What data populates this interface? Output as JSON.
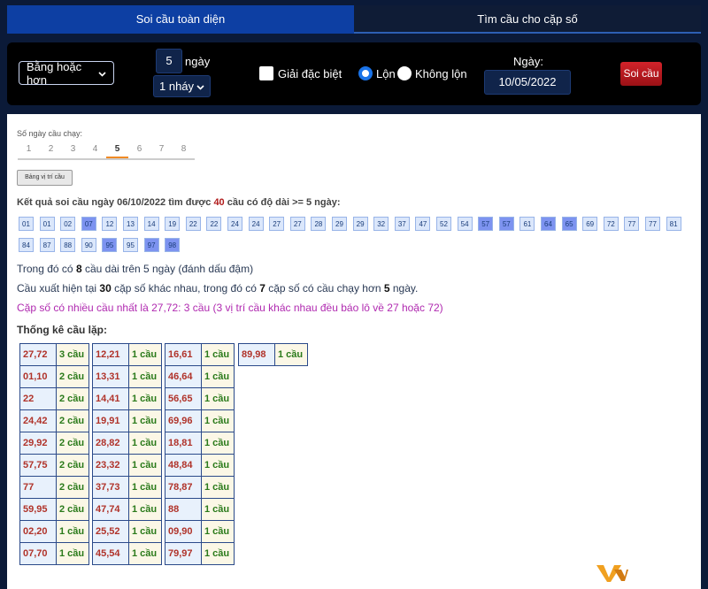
{
  "tabs": [
    {
      "label": "Soi cầu toàn diện"
    },
    {
      "label": "Tìm cầu cho cặp số"
    }
  ],
  "controls": {
    "mode_select": "Bằng hoặc hơn",
    "days_value": "5",
    "days_unit": "ngày",
    "jump_select": "1 nháy",
    "special_prize_label": "Giải đặc biệt",
    "radio_lon": "Lộn",
    "radio_khong_lon": "Không lộn",
    "date_label": "Ngày:",
    "date_value": "10/05/2022",
    "submit_label": "Soi cầu"
  },
  "content": {
    "days_title": "Số ngày cầu chạy:",
    "day_tabs": [
      "1",
      "2",
      "3",
      "4",
      "5",
      "6",
      "7",
      "8"
    ],
    "active_day": "5",
    "position_button": "Bảng vị trí cầu",
    "result_prefix": "Kết quả soi cầu ngày 06/10/2022 tìm được ",
    "result_count": "40",
    "result_suffix": " cầu có độ dài >= 5 ngày:",
    "chips": [
      {
        "v": "01",
        "b": false
      },
      {
        "v": "01",
        "b": false
      },
      {
        "v": "02",
        "b": false
      },
      {
        "v": "07",
        "b": true
      },
      {
        "v": "12",
        "b": false
      },
      {
        "v": "13",
        "b": false
      },
      {
        "v": "14",
        "b": false
      },
      {
        "v": "19",
        "b": false
      },
      {
        "v": "22",
        "b": false
      },
      {
        "v": "22",
        "b": false
      },
      {
        "v": "24",
        "b": false
      },
      {
        "v": "24",
        "b": false
      },
      {
        "v": "27",
        "b": false
      },
      {
        "v": "27",
        "b": false
      },
      {
        "v": "28",
        "b": false
      },
      {
        "v": "29",
        "b": false
      },
      {
        "v": "29",
        "b": false
      },
      {
        "v": "32",
        "b": false
      },
      {
        "v": "37",
        "b": false
      },
      {
        "v": "47",
        "b": false
      },
      {
        "v": "52",
        "b": false
      },
      {
        "v": "54",
        "b": false
      },
      {
        "v": "57",
        "b": true
      },
      {
        "v": "57",
        "b": true
      },
      {
        "v": "61",
        "b": false
      },
      {
        "v": "64",
        "b": true
      },
      {
        "v": "65",
        "b": true
      },
      {
        "v": "69",
        "b": false
      },
      {
        "v": "72",
        "b": false
      },
      {
        "v": "77",
        "b": false
      },
      {
        "v": "77",
        "b": false
      },
      {
        "v": "81",
        "b": false
      },
      {
        "v": "84",
        "b": false
      },
      {
        "v": "87",
        "b": false
      },
      {
        "v": "88",
        "b": false
      },
      {
        "v": "90",
        "b": false
      },
      {
        "v": "95",
        "b": true
      },
      {
        "v": "95",
        "b": false
      },
      {
        "v": "97",
        "b": true
      },
      {
        "v": "98",
        "b": true
      }
    ],
    "line1": {
      "a": "Trong đó có ",
      "b": "8",
      "c": " cầu dài trên 5 ngày (đánh dấu đậm)"
    },
    "line2": {
      "a": "Cầu xuất hiện tại ",
      "b": "30",
      "c": " cặp số khác nhau, trong đó có ",
      "d": "7",
      "e": " cặp số có cầu chạy hơn ",
      "f": "5",
      "g": " ngày."
    },
    "line3": "Cặp số có nhiều cầu nhất là 27,72: 3 cầu (3 vị trí cầu khác nhau đều báo lô về 27 hoặc 72)",
    "stat_title": "Thống kê cầu lặp:",
    "stat_tables": [
      [
        [
          "27,72",
          "3 cầu"
        ],
        [
          "01,10",
          "2 cầu"
        ],
        [
          "22",
          "2 cầu"
        ],
        [
          "24,42",
          "2 cầu"
        ],
        [
          "29,92",
          "2 cầu"
        ],
        [
          "57,75",
          "2 cầu"
        ],
        [
          "77",
          "2 cầu"
        ],
        [
          "59,95",
          "2 cầu"
        ],
        [
          "02,20",
          "1 cầu"
        ],
        [
          "07,70",
          "1 cầu"
        ]
      ],
      [
        [
          "12,21",
          "1 cầu"
        ],
        [
          "13,31",
          "1 cầu"
        ],
        [
          "14,41",
          "1 cầu"
        ],
        [
          "19,91",
          "1 cầu"
        ],
        [
          "28,82",
          "1 cầu"
        ],
        [
          "23,32",
          "1 cầu"
        ],
        [
          "37,73",
          "1 cầu"
        ],
        [
          "47,74",
          "1 cầu"
        ],
        [
          "25,52",
          "1 cầu"
        ],
        [
          "45,54",
          "1 cầu"
        ]
      ],
      [
        [
          "16,61",
          "1 cầu"
        ],
        [
          "46,64",
          "1 cầu"
        ],
        [
          "56,65",
          "1 cầu"
        ],
        [
          "69,96",
          "1 cầu"
        ],
        [
          "18,81",
          "1 cầu"
        ],
        [
          "48,84",
          "1 cầu"
        ],
        [
          "78,87",
          "1 cầu"
        ],
        [
          "88",
          "1 cầu"
        ],
        [
          "09,90",
          "1 cầu"
        ],
        [
          "79,97",
          "1 cầu"
        ]
      ],
      [
        [
          "89,98",
          "1 cầu"
        ]
      ]
    ]
  },
  "colors": {
    "tab_active": "#0d3fa3",
    "accent_red": "#b01a1a",
    "pair_red": "#b0332a",
    "count_green": "#2a7a1a",
    "highlight_purple": "#b02ab0"
  }
}
